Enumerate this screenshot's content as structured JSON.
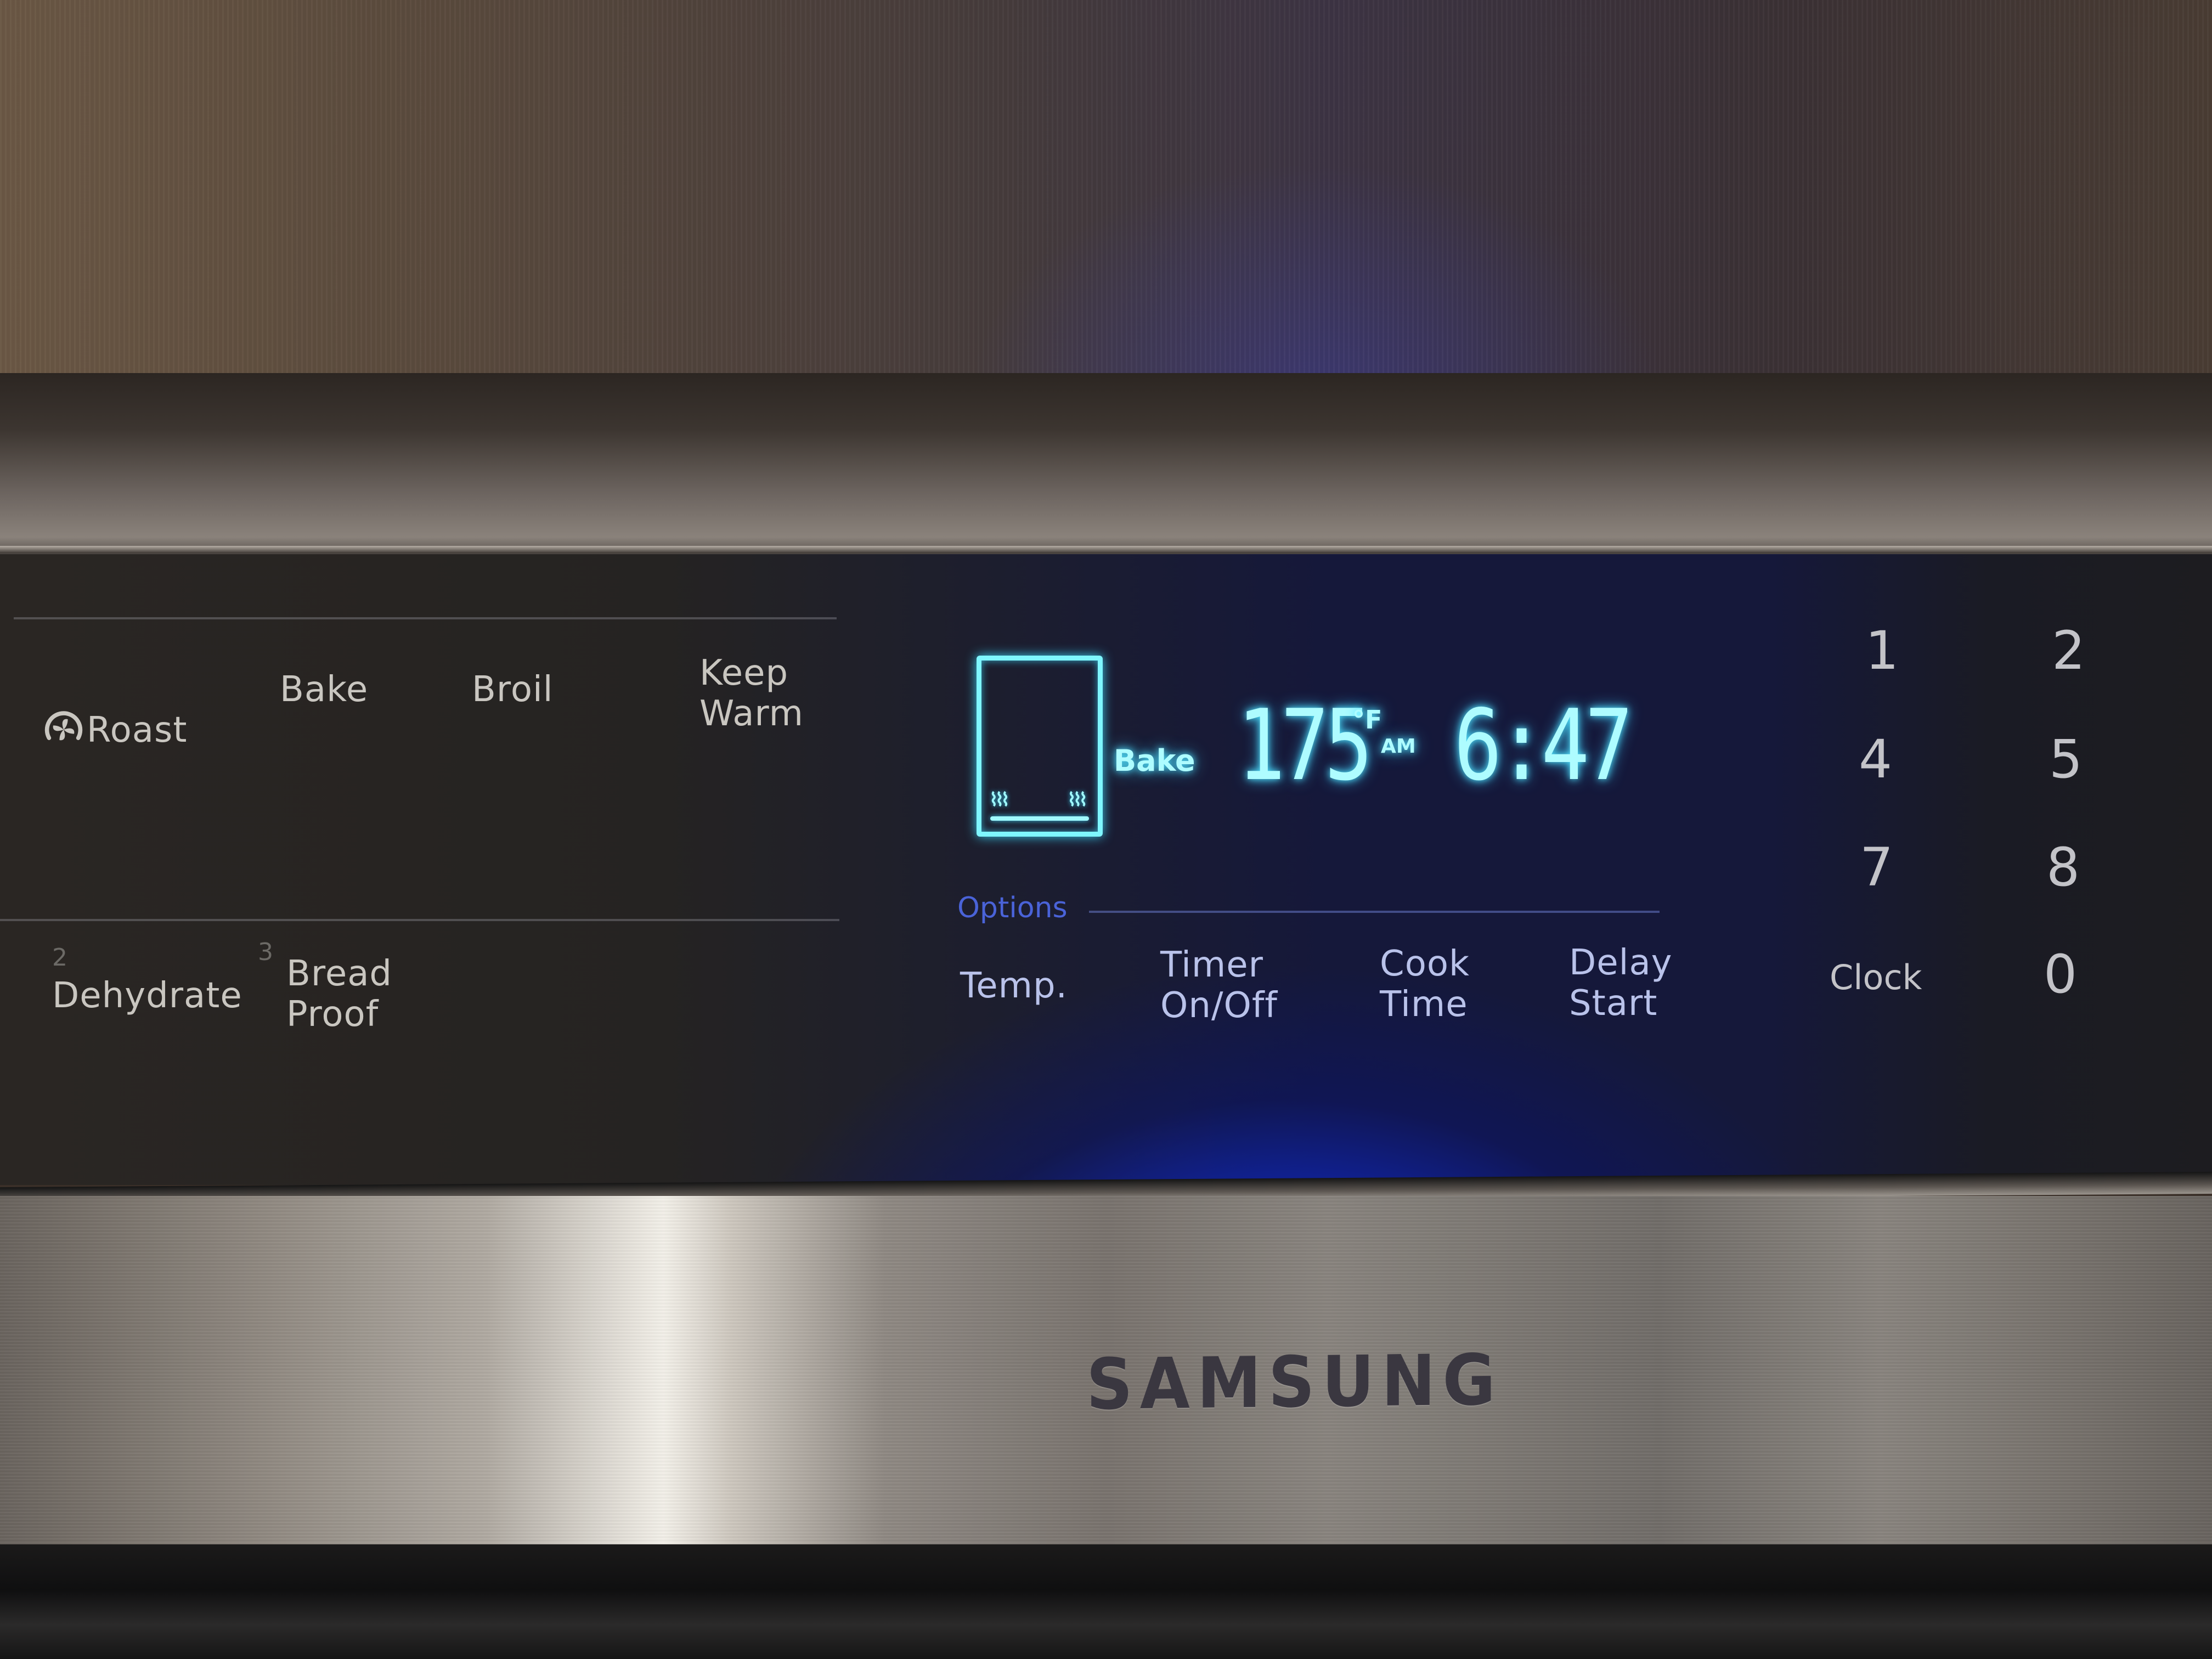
{
  "appliance": {
    "brand": "SAMSUNG",
    "type": "oven control panel"
  },
  "cook_modes": {
    "row1": [
      {
        "label": "Roast",
        "icon": "convection-fan-icon"
      },
      {
        "label": "Bake"
      },
      {
        "label": "Broil"
      },
      {
        "label": "Keep\nWarm"
      }
    ],
    "row2": [
      {
        "number": "2",
        "label": "Dehydrate"
      },
      {
        "number": "3",
        "label": "Bread\nProof"
      }
    ]
  },
  "display": {
    "mode_icon": "oven-bake-icon",
    "heat_glyph": "⌇⌇⌇",
    "mode_label": "Bake",
    "temperature": "175",
    "temperature_unit": "°F",
    "am_pm": "AM",
    "clock_time": "6:47",
    "colors": {
      "lcd_glow": "#aefcff",
      "backlight": "#1440ff"
    }
  },
  "options": {
    "title": "Options",
    "buttons": [
      {
        "label": "Temp."
      },
      {
        "label": "Timer\nOn/Off"
      },
      {
        "label": "Cook\nTime"
      },
      {
        "label": "Delay\nStart"
      }
    ]
  },
  "keypad": {
    "keys": [
      "1",
      "2",
      "4",
      "5",
      "7",
      "8",
      "Clock",
      "0"
    ]
  }
}
